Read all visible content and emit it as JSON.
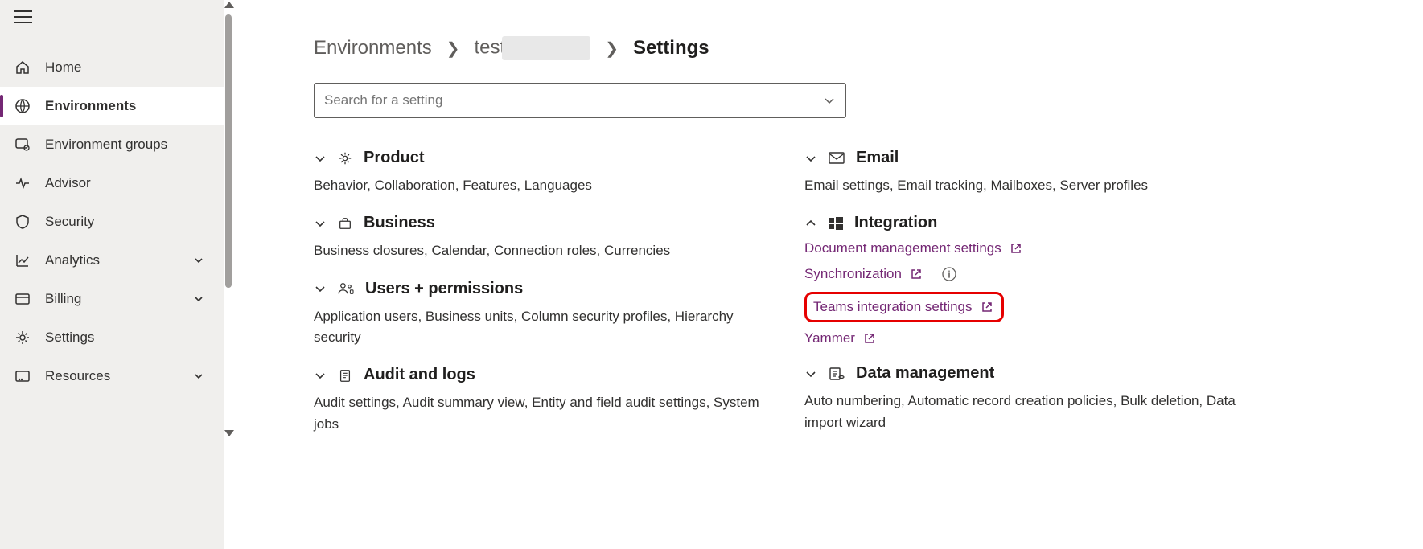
{
  "sidebar": {
    "items": [
      {
        "label": "Home"
      },
      {
        "label": "Environments"
      },
      {
        "label": "Environment groups"
      },
      {
        "label": "Advisor"
      },
      {
        "label": "Security"
      },
      {
        "label": "Analytics"
      },
      {
        "label": "Billing"
      },
      {
        "label": "Settings"
      },
      {
        "label": "Resources"
      }
    ]
  },
  "breadcrumb": {
    "root": "Environments",
    "env": "test",
    "current": "Settings"
  },
  "search": {
    "placeholder": "Search for a setting"
  },
  "groups": {
    "product": {
      "title": "Product",
      "sub": "Behavior, Collaboration, Features, Languages"
    },
    "business": {
      "title": "Business",
      "sub": "Business closures, Calendar, Connection roles, Currencies"
    },
    "users": {
      "title": "Users + permissions",
      "sub": "Application users, Business units, Column security profiles, Hierarchy security"
    },
    "audit": {
      "title": "Audit and logs",
      "sub": "Audit settings, Audit summary view, Entity and field audit settings, System jobs"
    },
    "email": {
      "title": "Email",
      "sub": "Email settings, Email tracking, Mailboxes, Server profiles"
    },
    "integration": {
      "title": "Integration",
      "links": {
        "doc": "Document management settings",
        "sync": "Synchronization",
        "teams": "Teams integration settings",
        "yammer": "Yammer"
      }
    },
    "data": {
      "title": "Data management",
      "sub": "Auto numbering, Automatic record creation policies, Bulk deletion, Data import wizard"
    }
  }
}
